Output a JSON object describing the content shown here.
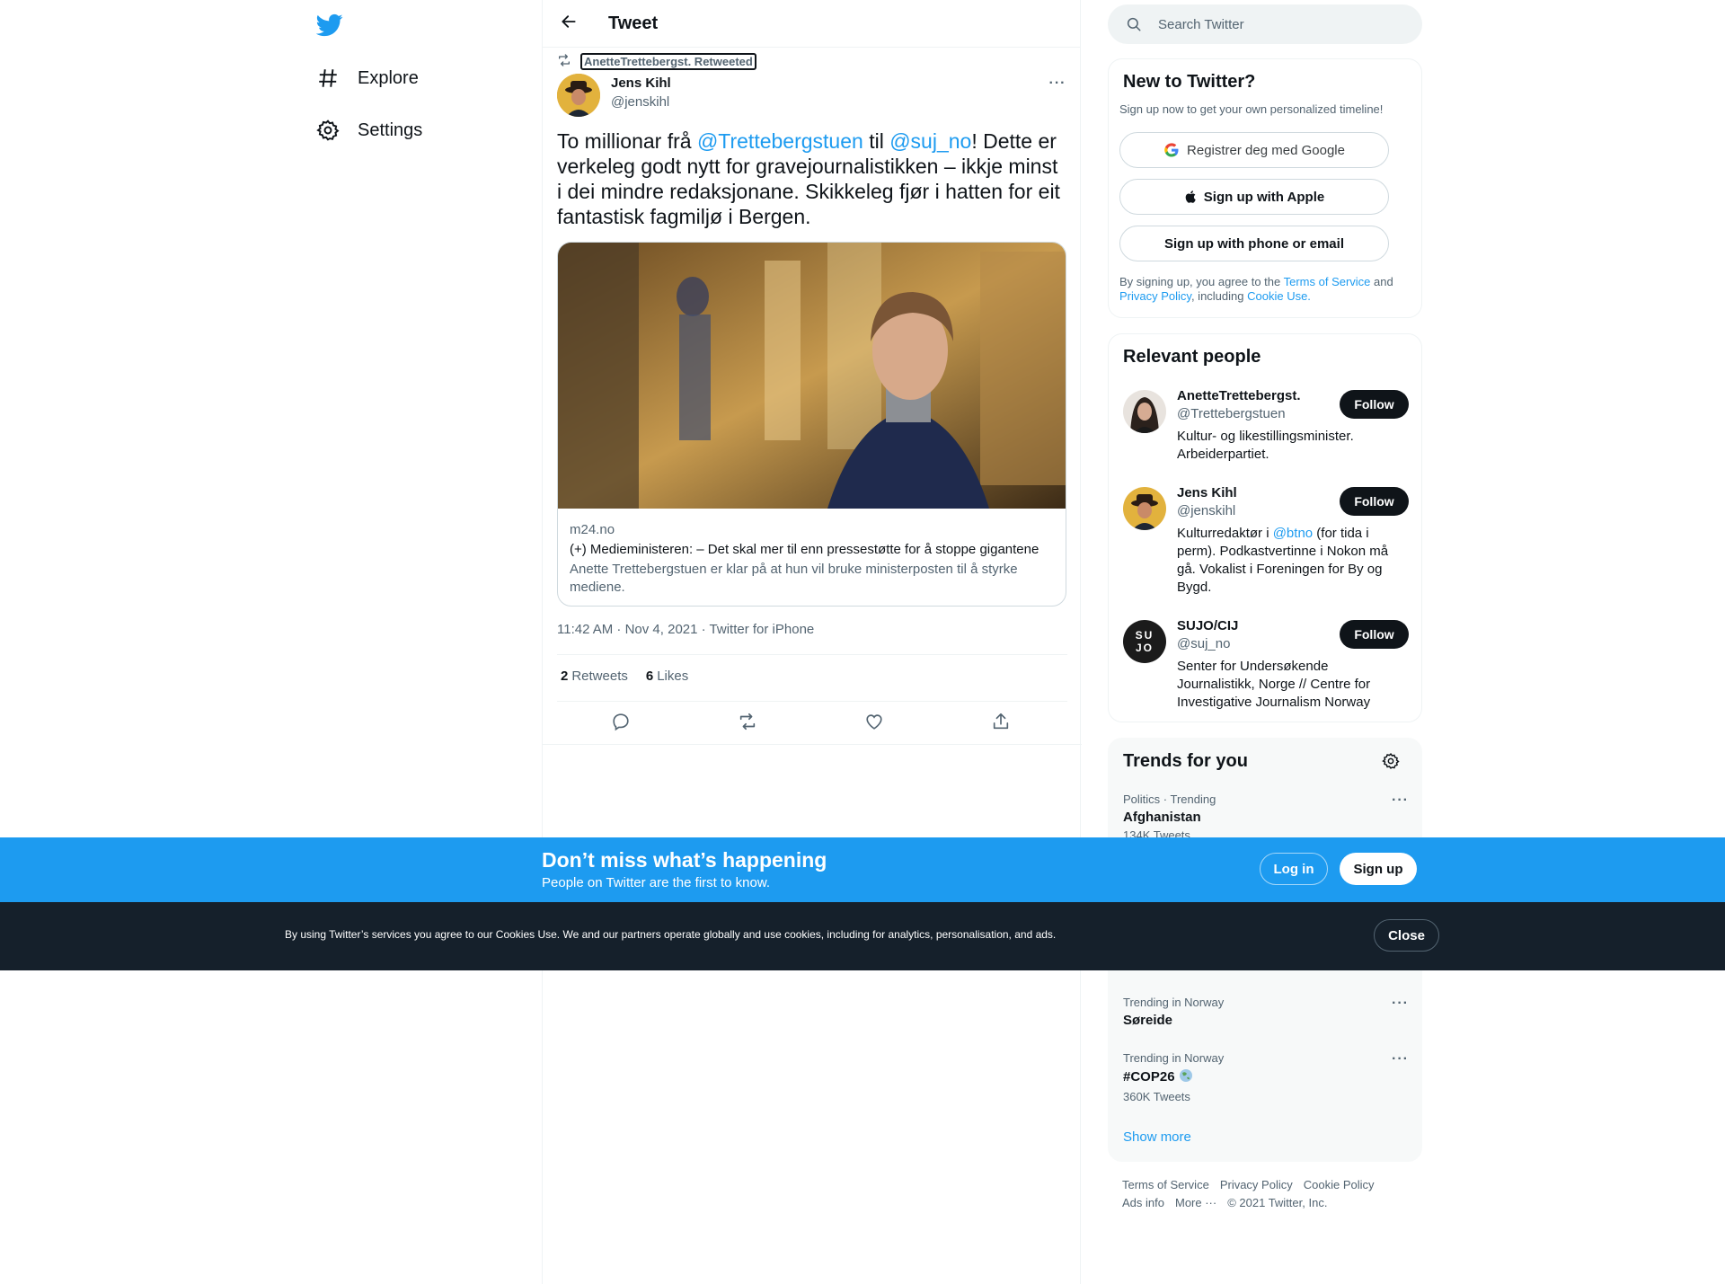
{
  "nav": {
    "explore_label": "Explore",
    "settings_label": "Settings"
  },
  "header": {
    "title": "Tweet"
  },
  "tweet": {
    "retweeted_by": "AnetteTrettebergst. Retweeted",
    "author_name": "Jens Kihl",
    "author_handle": "@jenskihl",
    "text_part1": "To millionar frå ",
    "mention1": "@Trettebergstuen",
    "text_part2": " til ",
    "mention2": "@suj_no",
    "text_part3": "! Dette er verkeleg godt nytt for gravejournalistikken – ikkje minst i dei mindre redaksjonane. Skikkeleg fjør i hatten for eit fantastisk fagmiljø i Bergen.",
    "card": {
      "domain": "m24.no",
      "title": "(+) Medieministeren: – Det skal mer til enn pressestøtte for å stoppe gigantene",
      "description": "Anette Trettebergstuen er klar på at hun vil bruke ministerposten til å styrke mediene."
    },
    "timestamp": "11:42 AM · Nov 4, 2021 · Twitter for iPhone",
    "retweets_count": "2",
    "retweets_label": "Retweets",
    "likes_count": "6",
    "likes_label": "Likes"
  },
  "search": {
    "placeholder": "Search Twitter"
  },
  "signup_panel": {
    "title": "New to Twitter?",
    "subtitle": "Sign up now to get your own personalized timeline!",
    "google_label": "Registrer deg med Google",
    "apple_label": "Sign up with Apple",
    "phone_label": "Sign up with phone or email",
    "legal_prefix": "By signing up, you agree to the ",
    "terms_link": "Terms of Service",
    "legal_and": " and ",
    "privacy_link": "Privacy Policy",
    "legal_including": ", including ",
    "cookie_link": "Cookie Use."
  },
  "relevant_people": {
    "title": "Relevant people",
    "follow_label": "Follow",
    "people": [
      {
        "name": "AnetteTrettebergst.",
        "handle": "@Trettebergstuen",
        "bio": "Kultur- og likestillingsminister. Arbeiderpartiet."
      },
      {
        "name": "Jens Kihl",
        "handle": "@jenskihl",
        "bio_prefix": "Kulturredaktør i ",
        "bio_link": "@btno",
        "bio_suffix": " (for tida i perm). Podkastvertinne i Nokon må gå. Vokalist i Foreningen for By og Bygd."
      },
      {
        "name": "SUJO/CIJ",
        "handle": "@suj_no",
        "bio": "Senter for Undersøkende Journalistikk, Norge // Centre for Investigative Journalism Norway",
        "avatar_text": "SU JO"
      }
    ]
  },
  "trends": {
    "title": "Trends for you",
    "items": [
      {
        "meta": "Politics · Trending",
        "name": "Afghanistan",
        "count": "134K Tweets"
      },
      {
        "meta": "Trending in Norway",
        "name": "Søreide",
        "count": ""
      },
      {
        "meta": "Trending in Norway",
        "name": "#COP26",
        "count": "360K Tweets"
      }
    ],
    "show_more": "Show more"
  },
  "footer": {
    "terms": "Terms of Service",
    "privacy": "Privacy Policy",
    "cookie": "Cookie Policy",
    "ads": "Ads info",
    "more": "More ···",
    "copyright": "© 2021 Twitter, Inc."
  },
  "banner": {
    "title": "Don’t miss what’s happening",
    "subtitle": "People on Twitter are the first to know.",
    "login_label": "Log in",
    "signup_label": "Sign up"
  },
  "cookie_banner": {
    "text": "By using Twitter’s services you agree to our Cookies Use. We and our partners operate globally and use cookies, including for analytics, personalisation, and ads.",
    "close_label": "Close"
  },
  "colors": {
    "brand_blue": "#1d9bf0",
    "text_dark": "#0f1419",
    "text_muted": "#536471",
    "cookie_bg": "#15202b"
  }
}
